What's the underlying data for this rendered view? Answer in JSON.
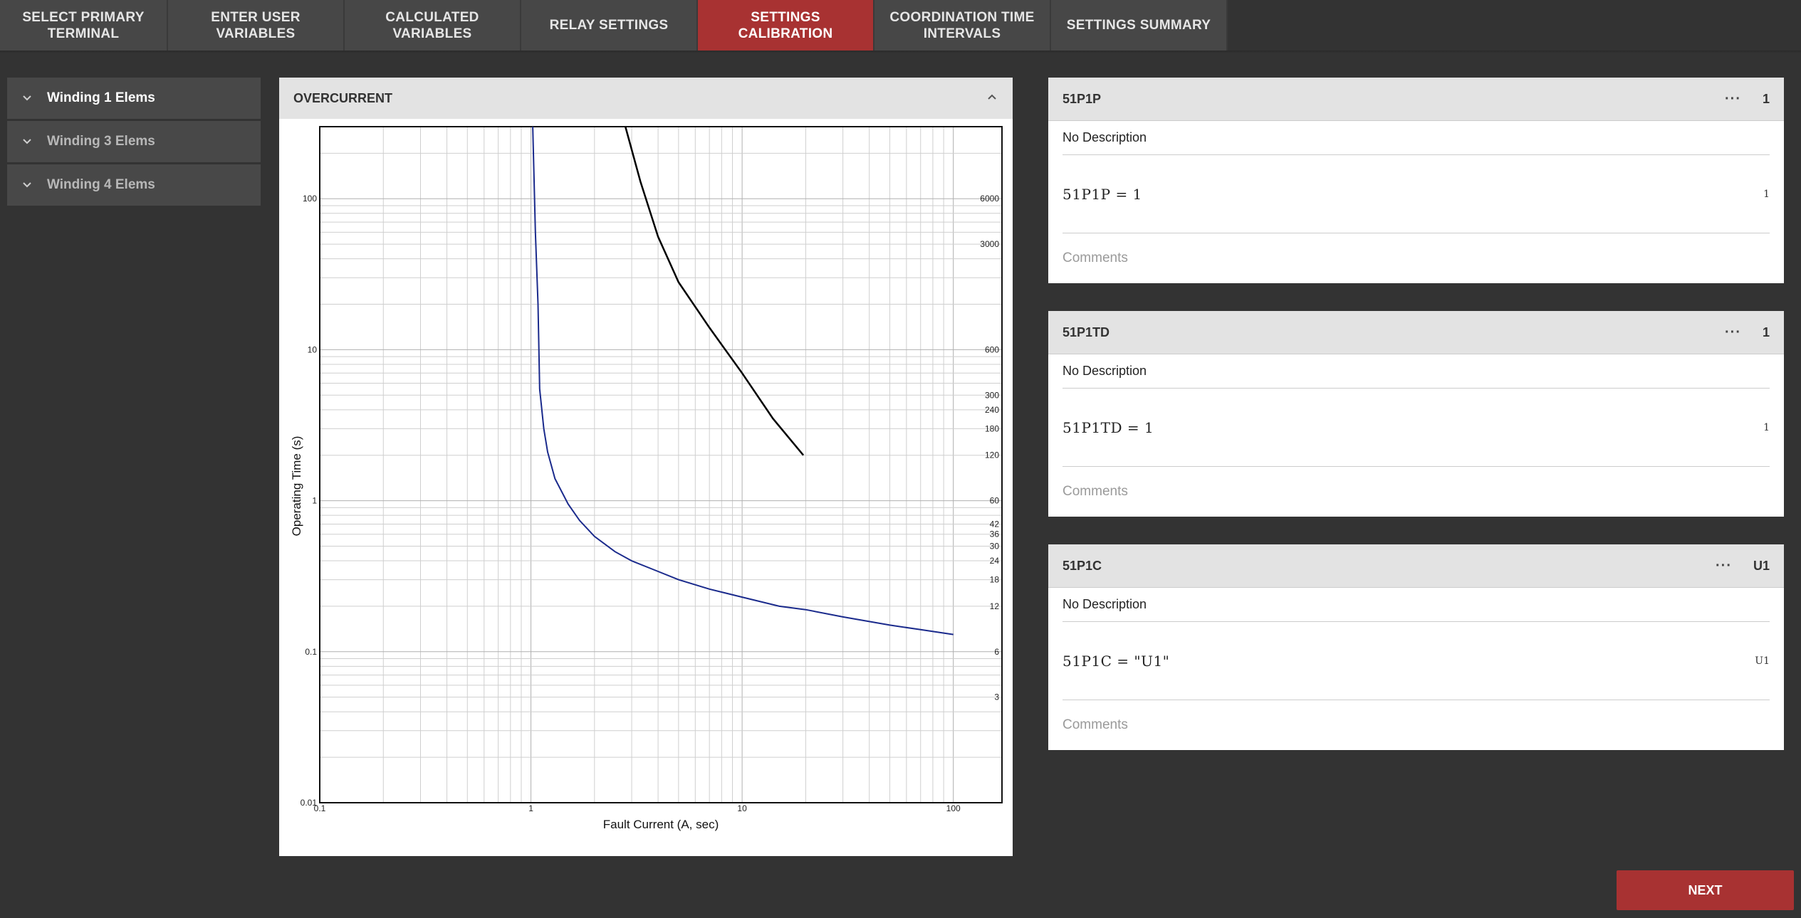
{
  "tabs": [
    {
      "label": "SELECT PRIMARY\nTERMINAL"
    },
    {
      "label": "ENTER USER\nVARIABLES"
    },
    {
      "label": "CALCULATED\nVARIABLES"
    },
    {
      "label": "RELAY SETTINGS"
    },
    {
      "label": "SETTINGS\nCALIBRATION"
    },
    {
      "label": "COORDINATION TIME\nINTERVALS"
    },
    {
      "label": "SETTINGS SUMMARY"
    }
  ],
  "sidebar": {
    "items": [
      {
        "label": "Winding 1 Elems"
      },
      {
        "label": "Winding 3 Elems"
      },
      {
        "label": "Winding 4 Elems"
      }
    ]
  },
  "chart_panel": {
    "title": "OVERCURRENT"
  },
  "chart_data": {
    "type": "line",
    "xscale": "log",
    "yscale": "log",
    "xlim": [
      0.1,
      170
    ],
    "ylim": [
      0.01,
      300
    ],
    "xlabel": "Fault Current (A, sec)",
    "ylabel": "Operating Time (s)",
    "x_ticks": [
      "0.1",
      "1",
      "10",
      "100"
    ],
    "y_ticks": [
      "0.01",
      "0.1",
      "1",
      "10",
      "100"
    ],
    "y_ticks_right": [
      "3",
      "6",
      "12",
      "18",
      "24",
      "30",
      "36",
      "42",
      "60",
      "120",
      "180",
      "240",
      "300",
      "600",
      "3000",
      "6000"
    ],
    "grid": true,
    "series": [
      {
        "color": "#1a2a8c",
        "x": [
          1.02,
          1.05,
          1.08,
          1.1,
          1.15,
          1.2,
          1.3,
          1.5,
          1.7,
          2,
          2.5,
          3,
          4,
          5,
          7,
          10,
          15,
          20,
          30,
          50,
          70,
          100
        ],
        "y": [
          300,
          60,
          20,
          5.5,
          3,
          2.1,
          1.4,
          0.95,
          0.74,
          0.58,
          0.46,
          0.4,
          0.34,
          0.3,
          0.26,
          0.23,
          0.2,
          0.19,
          0.17,
          0.15,
          0.14,
          0.13
        ]
      },
      {
        "color": "#000000",
        "x": [
          2.8,
          3.3,
          4,
          5,
          7,
          10,
          14,
          19.5
        ],
        "y": [
          300,
          130,
          56,
          28,
          14,
          7,
          3.5,
          2
        ]
      }
    ]
  },
  "cards": [
    {
      "name": "51P1P",
      "value": "1",
      "description": "No Description",
      "expression": "51P1P = 1",
      "expr_value": "1",
      "comments": "Comments"
    },
    {
      "name": "51P1TD",
      "value": "1",
      "description": "No Description",
      "expression": "51P1TD = 1",
      "expr_value": "1",
      "comments": "Comments"
    },
    {
      "name": "51P1C",
      "value": "U1",
      "description": "No Description",
      "expression": "51P1C = \"U1\"",
      "expr_value": "U1",
      "comments": "Comments"
    }
  ],
  "card_dots": "···",
  "next_button": {
    "label": "NEXT"
  }
}
